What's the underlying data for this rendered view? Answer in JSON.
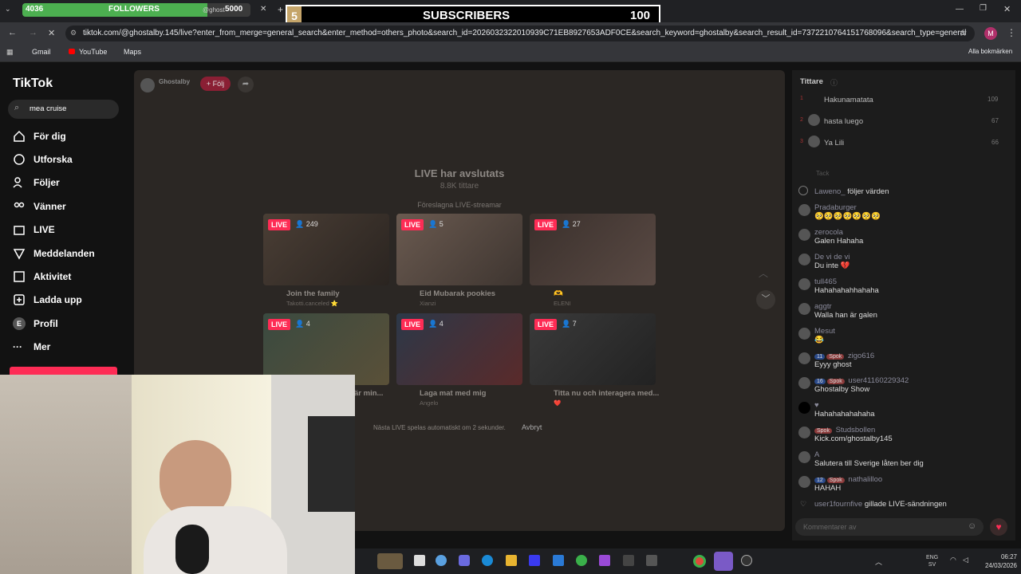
{
  "browser": {
    "tab_title": "@ghost",
    "url": "tiktok.com/@ghostalby.145/live?enter_from_merge=general_search&enter_method=others_photo&search_id=2026032322010939C71EB8927653ADF0CE&search_keyword=ghostalby&search_result_id=7372210764151768096&search_type=general",
    "bookmarks": [
      "Gmail",
      "YouTube",
      "Maps"
    ],
    "all_bookmarks": "Alla bokmärken",
    "profile_initial": "M"
  },
  "overlay": {
    "followers_count": "4036",
    "followers_label": "FOLLOWERS",
    "followers_goal": "5000",
    "followers_progress": 0.81,
    "subs_count": "5",
    "subs_label": "SUBSCRIBERS",
    "subs_goal": "100"
  },
  "sidebar": {
    "logo": "TikTok",
    "search_value": "mea cruise",
    "items": [
      {
        "label": "För dig"
      },
      {
        "label": "Utforska"
      },
      {
        "label": "Följer"
      },
      {
        "label": "Vänner"
      },
      {
        "label": "LIVE"
      },
      {
        "label": "Meddelanden"
      },
      {
        "label": "Aktivitet"
      },
      {
        "label": "Ladda upp"
      },
      {
        "label": "Profil"
      },
      {
        "label": "Mer"
      }
    ],
    "profile_initial": "E"
  },
  "stream": {
    "host": "Ghostalby",
    "follow_label": "+ Följ",
    "ended_title": "LIVE har avslutats",
    "viewers": "8.8K tittare",
    "suggested_label": "Föreslagna LIVE-streamar",
    "next_label": "Nästa LIVE spelas automatiskt om 2 sekunder.",
    "cancel_label": "Avbryt",
    "live_badge": "LIVE",
    "cards": [
      {
        "count": "249",
        "title": "Join the family",
        "sub": "Takotti.canceled ⭐"
      },
      {
        "count": "5",
        "title": "Eid Mubarak pookies",
        "sub": "Xianzi"
      },
      {
        "count": "27",
        "title": "🫶",
        "sub": "ELENI"
      },
      {
        "count": "4",
        "title": "är min...",
        "sub": ""
      },
      {
        "count": "4",
        "title": "Laga mat med mig",
        "sub": "Angelo"
      },
      {
        "count": "7",
        "title": "Titta nu och interagera med...",
        "sub": "❤️"
      }
    ]
  },
  "chat": {
    "viewers_title": "Tittare",
    "top_viewers": [
      {
        "rank": "1",
        "name": "Hakunamatata",
        "score": "109"
      },
      {
        "rank": "2",
        "name": "hasta luego",
        "score": "67"
      },
      {
        "rank": "3",
        "name": "Ya Lili",
        "score": "66"
      }
    ],
    "faded": "Tack",
    "messages": [
      {
        "name": "Laweno_",
        "text": "följer värden"
      },
      {
        "name": "Pradaburger",
        "text": "🥺🥺🥺🥺🥺🥺🥺"
      },
      {
        "name": "zerocola",
        "text": "Galen Hahaha"
      },
      {
        "name": "De vi de vi",
        "text": "Du inte 💔"
      },
      {
        "name": "tull465",
        "text": "Hahahahahhahaha"
      },
      {
        "name": "aggtr",
        "text": "Walla han är galen"
      },
      {
        "name": "Mesut",
        "text": "😂"
      },
      {
        "name": "zigo616",
        "text": "Eyyy ghost",
        "b1": "11",
        "b2": "Spok"
      },
      {
        "name": "user41160229342",
        "text": "Ghostalby Show",
        "b1": "16",
        "b2": "Spok"
      },
      {
        "name": "",
        "text": "Hahahahahahaha"
      },
      {
        "name": "Studsbollen",
        "text": "Kick.com/ghostalby145",
        "b2": "Spok"
      },
      {
        "name": "A",
        "text": "Salutera till Sverige låten ber dig"
      },
      {
        "name": "nathalilloo",
        "text": "HAHAH",
        "b1": "12",
        "b2": "Spok"
      },
      {
        "name": "user1fournfive",
        "text": "gillade LIVE-sändningen"
      }
    ],
    "comment_placeholder": "Kommentarer av"
  },
  "taskbar": {
    "lang": "ENG",
    "lang2": "SV",
    "time": "06:27",
    "date": "24/03/2026"
  }
}
